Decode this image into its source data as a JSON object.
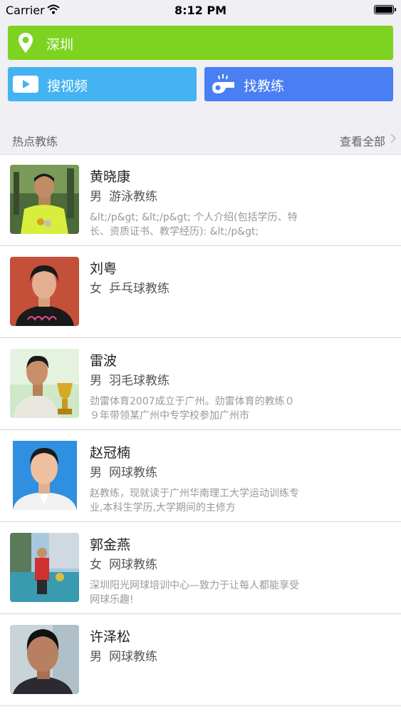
{
  "status_bar": {
    "carrier": "Carrier",
    "time": "8:12 PM"
  },
  "location": {
    "city": "深圳",
    "color": "#7ed321"
  },
  "actions": {
    "search_video": {
      "label": "搜视频",
      "color": "#45b3f2",
      "icon": "play-video-icon"
    },
    "find_coach": {
      "label": "找教练",
      "color": "#4a7ff3",
      "icon": "whistle-icon"
    }
  },
  "section": {
    "title": "热点教练",
    "view_all": "查看全部"
  },
  "coaches": [
    {
      "name": "黄晓康",
      "gender": "男",
      "sport": "游泳教练",
      "description": "&lt;/p&gt; &lt;/p&gt; 个人介绍(包括学历、特长、资质证书、教学经历): &lt;/p&gt;"
    },
    {
      "name": "刘粤",
      "gender": "女",
      "sport": "乒乓球教练",
      "description": ""
    },
    {
      "name": "雷波",
      "gender": "男",
      "sport": "羽毛球教练",
      "description": "劲雷体育2007成立于广州。劲雷体育的教练０９年带领某广州中专学校参加广州市"
    },
    {
      "name": "赵冠楠",
      "gender": "男",
      "sport": "网球教练",
      "description": "赵教练，现就读于广州华南理工大学运动训练专业,本科生学历,大学期间的主修方"
    },
    {
      "name": "郭金燕",
      "gender": "女",
      "sport": "网球教练",
      "description": "深圳阳光网球培训中心—致力于让每人都能享受网球乐趣!"
    },
    {
      "name": "许泽松",
      "gender": "男",
      "sport": "网球教练",
      "description": ""
    }
  ]
}
